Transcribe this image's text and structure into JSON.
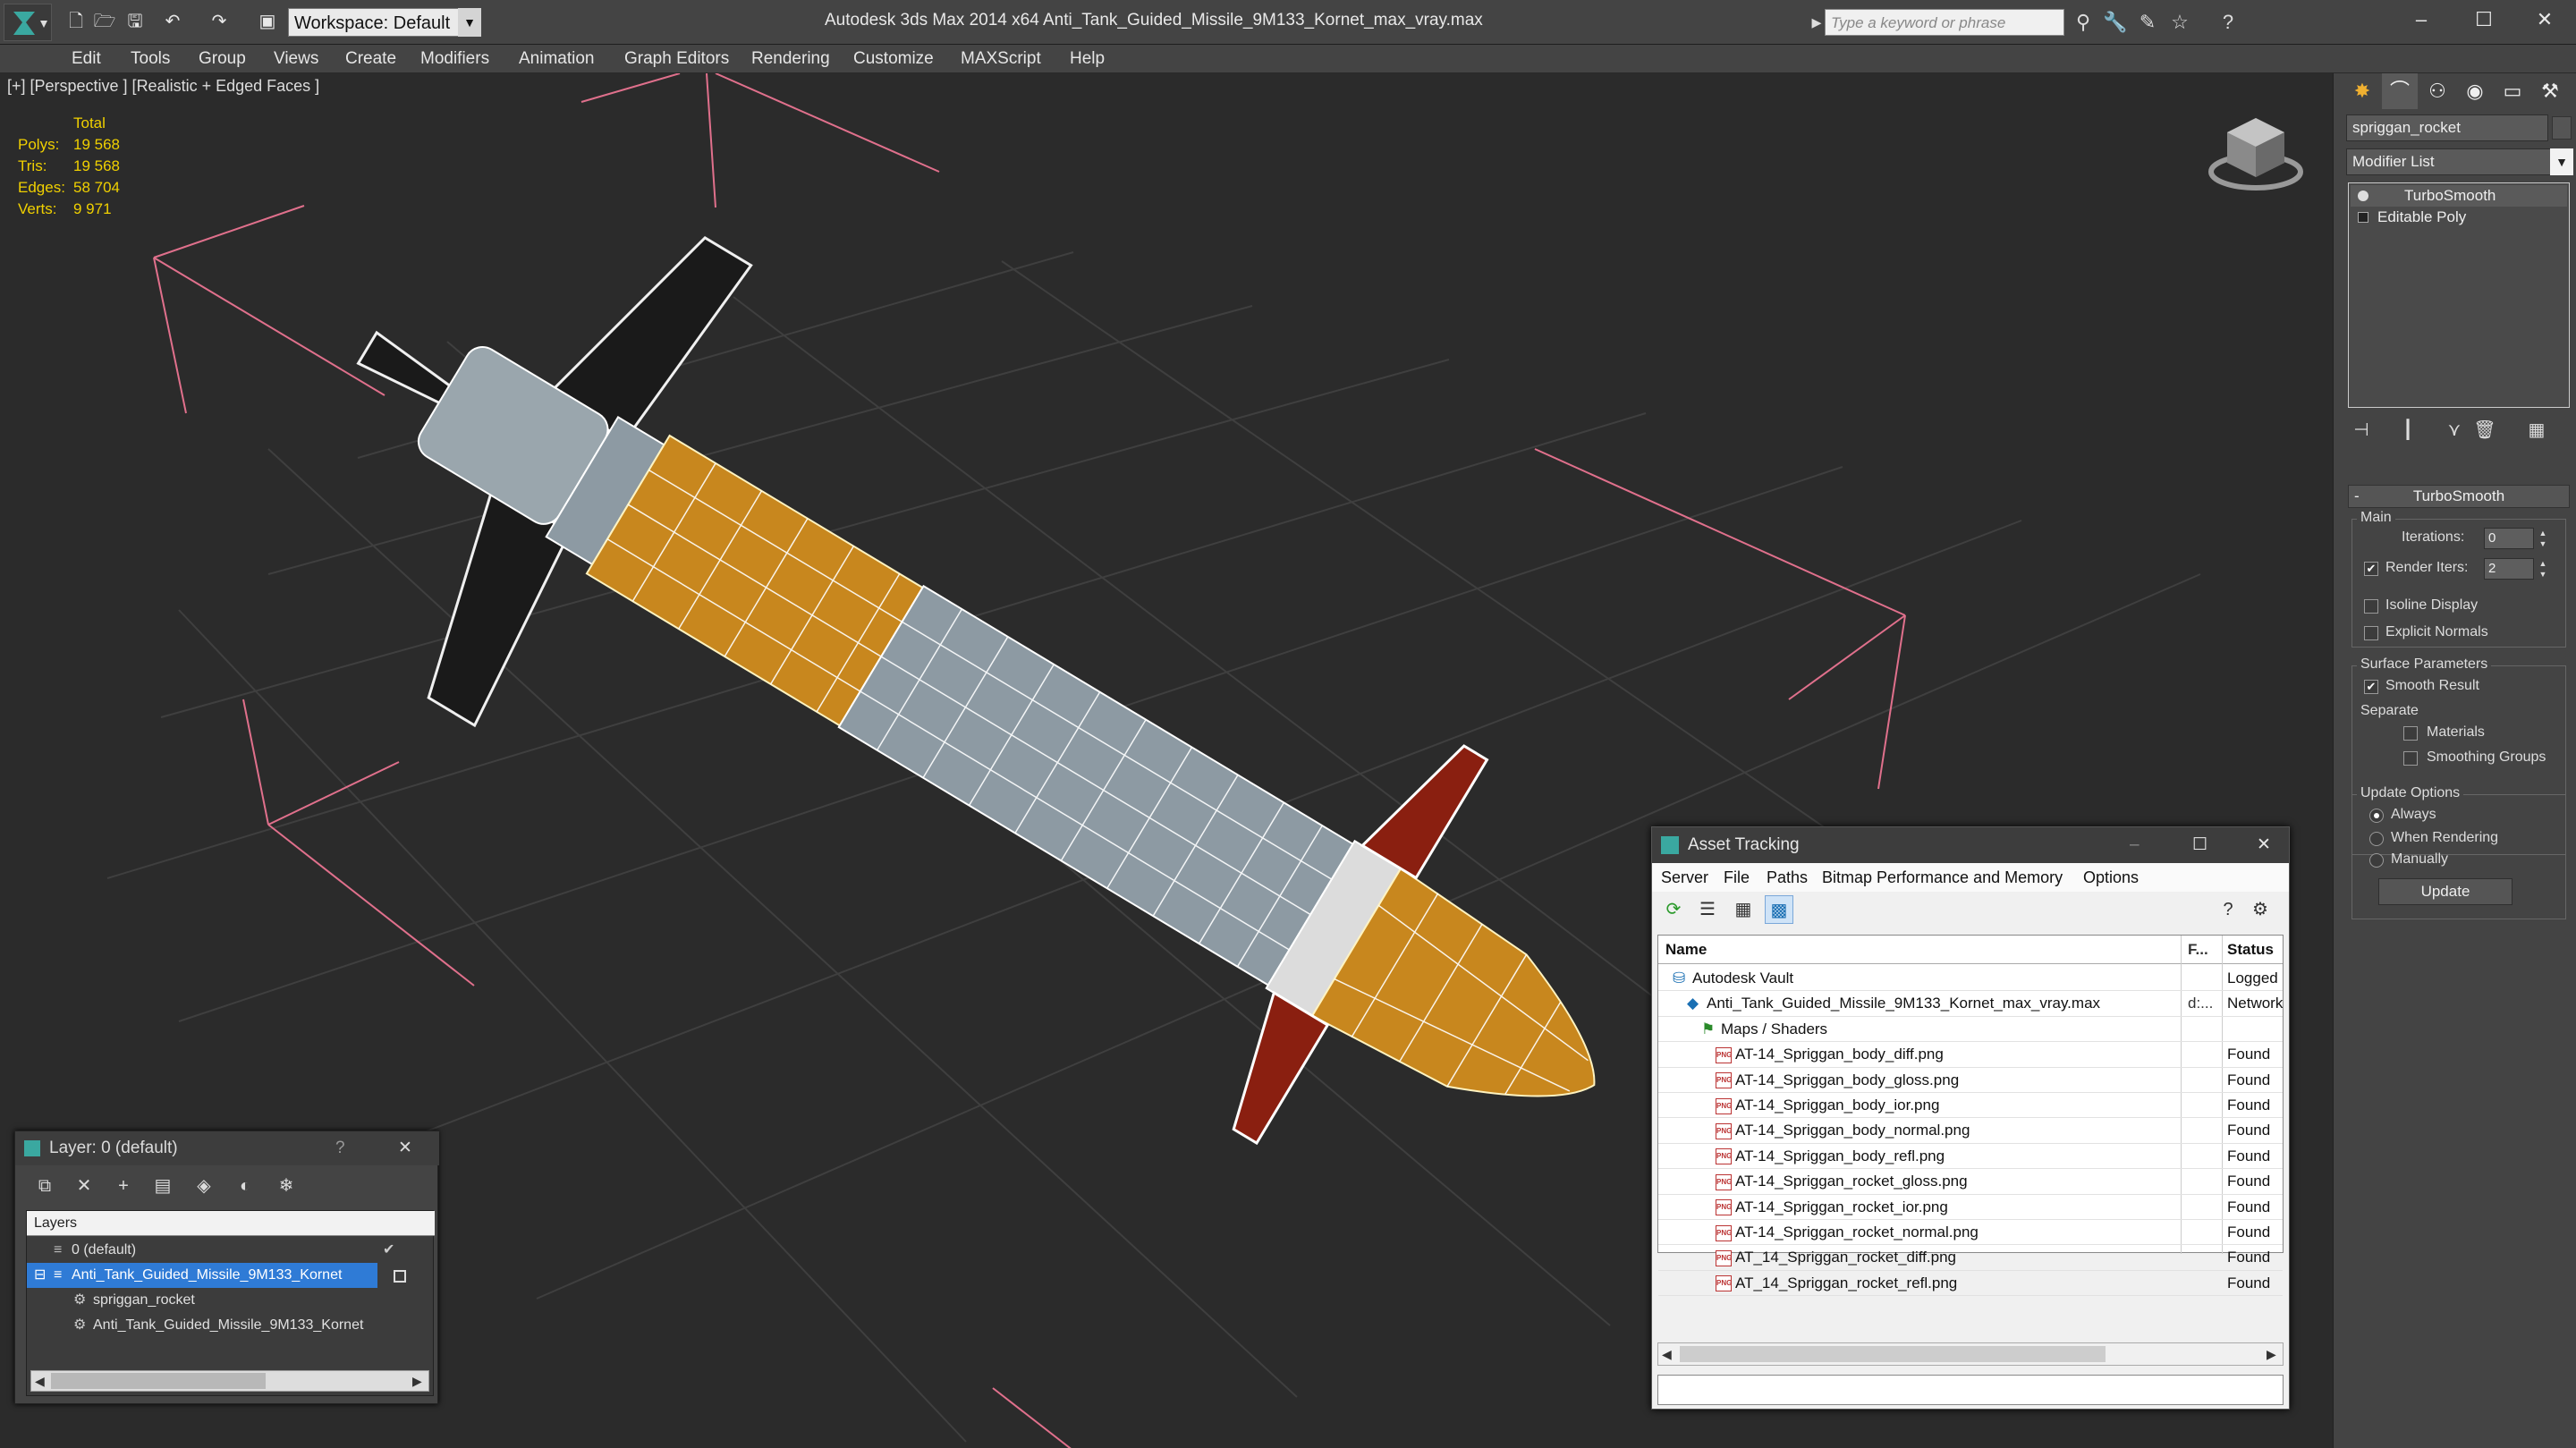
{
  "window": {
    "title": "Autodesk 3ds Max  2014 x64     Anti_Tank_Guided_Missile_9M133_Kornet_max_vray.max",
    "workspace": "Workspace: Default",
    "search_placeholder": "Type a keyword or phrase"
  },
  "menu": [
    "Edit",
    "Tools",
    "Group",
    "Views",
    "Create",
    "Modifiers",
    "Animation",
    "Graph Editors",
    "Rendering",
    "Customize",
    "MAXScript",
    "Help"
  ],
  "viewport": {
    "label": "[+] [Perspective ] [Realistic + Edged Faces ]",
    "stats": {
      "header": "Total",
      "rows": [
        {
          "label": "Polys:",
          "value": "19 568"
        },
        {
          "label": "Tris:",
          "value": "19 568"
        },
        {
          "label": "Edges:",
          "value": "58 704"
        },
        {
          "label": "Verts:",
          "value": "9 971"
        }
      ]
    }
  },
  "command_panel": {
    "object_name": "spriggan_rocket",
    "modifier_list": "Modifier List",
    "stack": [
      "TurboSmooth",
      "Editable Poly"
    ],
    "rollout_title": "TurboSmooth",
    "main_group": "Main",
    "iterations_label": "Iterations:",
    "iterations_value": "0",
    "render_iters_label": "Render Iters:",
    "render_iters_value": "2",
    "render_iters_checked": "✔",
    "isoline_display": "Isoline Display",
    "explicit_normals": "Explicit Normals",
    "surface_params_group": "Surface Parameters",
    "smooth_result": "Smooth Result",
    "smooth_result_checked": "✔",
    "separate_label": "Separate",
    "materials": "Materials",
    "smoothing_groups": "Smoothing Groups",
    "update_options_group": "Update Options",
    "always": "Always",
    "when_rendering": "When Rendering",
    "manually": "Manually",
    "update_button": "Update"
  },
  "layer_dialog": {
    "title": "Layer: 0 (default)",
    "help": "?",
    "close": "✕",
    "header": "Layers",
    "rows": [
      {
        "name": "0 (default)",
        "indent": 1,
        "selected": false
      },
      {
        "name": "Anti_Tank_Guided_Missile_9M133_Kornet",
        "indent": 1,
        "selected": true
      },
      {
        "name": "spriggan_rocket",
        "indent": 2,
        "selected": false
      },
      {
        "name": "Anti_Tank_Guided_Missile_9M133_Kornet",
        "indent": 2,
        "selected": false
      }
    ]
  },
  "asset_dialog": {
    "title": "Asset Tracking",
    "menu": [
      "Server",
      "File",
      "Paths",
      "Bitmap Performance and Memory",
      "Options"
    ],
    "columns": {
      "name": "Name",
      "f": "F...",
      "status": "Status"
    },
    "rows": [
      {
        "name": "Autodesk Vault",
        "f": "",
        "status": "Logged",
        "indent": 1,
        "icon": "vault"
      },
      {
        "name": "Anti_Tank_Guided_Missile_9M133_Kornet_max_vray.max",
        "f": "d:...",
        "status": "Network",
        "indent": 2,
        "icon": "max"
      },
      {
        "name": "Maps / Shaders",
        "f": "",
        "status": "",
        "indent": 3,
        "icon": "maps"
      },
      {
        "name": "AT-14_Spriggan_body_diff.png",
        "f": "",
        "status": "Found",
        "indent": 4,
        "icon": "png"
      },
      {
        "name": "AT-14_Spriggan_body_gloss.png",
        "f": "",
        "status": "Found",
        "indent": 4,
        "icon": "png"
      },
      {
        "name": "AT-14_Spriggan_body_ior.png",
        "f": "",
        "status": "Found",
        "indent": 4,
        "icon": "png"
      },
      {
        "name": "AT-14_Spriggan_body_normal.png",
        "f": "",
        "status": "Found",
        "indent": 4,
        "icon": "png"
      },
      {
        "name": "AT-14_Spriggan_body_refl.png",
        "f": "",
        "status": "Found",
        "indent": 4,
        "icon": "png"
      },
      {
        "name": "AT-14_Spriggan_rocket_gloss.png",
        "f": "",
        "status": "Found",
        "indent": 4,
        "icon": "png"
      },
      {
        "name": "AT-14_Spriggan_rocket_ior.png",
        "f": "",
        "status": "Found",
        "indent": 4,
        "icon": "png"
      },
      {
        "name": "AT-14_Spriggan_rocket_normal.png",
        "f": "",
        "status": "Found",
        "indent": 4,
        "icon": "png"
      },
      {
        "name": "AT_14_Spriggan_rocket_diff.png",
        "f": "",
        "status": "Found",
        "indent": 4,
        "icon": "png"
      },
      {
        "name": "AT_14_Spriggan_rocket_refl.png",
        "f": "",
        "status": "Found",
        "indent": 4,
        "icon": "png"
      }
    ]
  },
  "colors": {
    "ui_bg": "#444444",
    "viewport_bg": "#2b2b2b",
    "stats_text": "#f0d000",
    "missile_orange": "#c8871e",
    "missile_grey": "#8d9aa3",
    "fin_red": "#8a1f10",
    "selection_blue": "#2f7bd6"
  }
}
